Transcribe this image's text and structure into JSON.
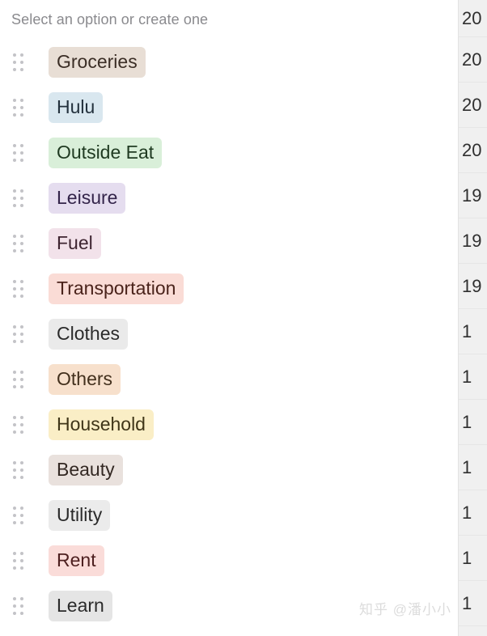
{
  "picker": {
    "header": "Select an option or create one",
    "drag_handle_icon": "drag-handle-dots-icon",
    "options": [
      {
        "label": "Groceries",
        "bg": "#e8ded5",
        "fg": "#3b2e26"
      },
      {
        "label": "Hulu",
        "bg": "#d9e7ef",
        "fg": "#23313d"
      },
      {
        "label": "Outside Eat",
        "bg": "#d9efd9",
        "fg": "#1f3a21"
      },
      {
        "label": "Leisure",
        "bg": "#e5ddef",
        "fg": "#33244a"
      },
      {
        "label": "Fuel",
        "bg": "#f2e2ea",
        "fg": "#3d2430"
      },
      {
        "label": "Transportation",
        "bg": "#fadcd6",
        "fg": "#4a231b"
      },
      {
        "label": "Clothes",
        "bg": "#eaeaea",
        "fg": "#2b2b2b"
      },
      {
        "label": "Others",
        "bg": "#f7e0cc",
        "fg": "#43301d"
      },
      {
        "label": "Household",
        "bg": "#faeec6",
        "fg": "#3f3518"
      },
      {
        "label": "Beauty",
        "bg": "#e9e1dd",
        "fg": "#332823"
      },
      {
        "label": "Utility",
        "bg": "#ebebeb",
        "fg": "#2b2b2b"
      },
      {
        "label": "Rent",
        "bg": "#fadcd9",
        "fg": "#4d1f1f"
      },
      {
        "label": "Learn",
        "bg": "#e5e5e5",
        "fg": "#2b2b2b"
      }
    ]
  },
  "background_table": {
    "clipped_values": [
      "20",
      "20",
      "20",
      "20",
      "19",
      "19",
      "19",
      "1",
      "1",
      "1",
      "1",
      "1",
      "1",
      "1"
    ]
  },
  "watermark": {
    "text": "知乎 @潘小小"
  }
}
